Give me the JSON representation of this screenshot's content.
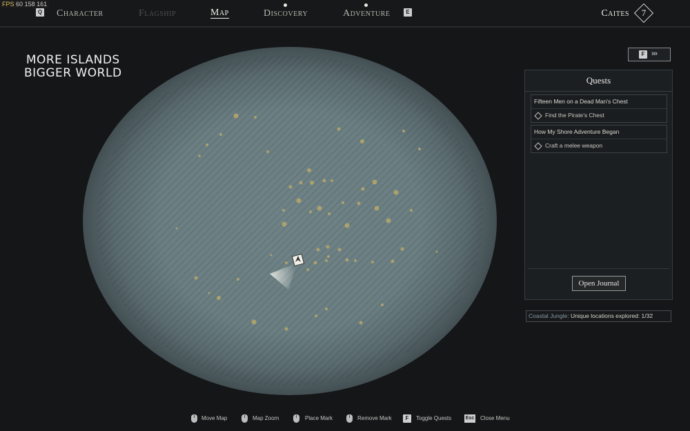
{
  "debug": {
    "fps_label": "FPS",
    "fps_value": "60",
    "extra": "158 161"
  },
  "nav": {
    "left_key": "Q",
    "right_key": "E",
    "tabs": [
      {
        "label": "Character"
      },
      {
        "label": "Flagship"
      },
      {
        "label": "Map"
      },
      {
        "label": "Discovery"
      },
      {
        "label": "Adventure"
      }
    ],
    "active_tab": "Map",
    "disabled_tab": "Flagship"
  },
  "player": {
    "name": "Caites",
    "level": "7"
  },
  "overlay_text": {
    "line1": "MORE ISLANDS",
    "line2": "BIGGER WORLD"
  },
  "expand_button": {
    "key": "F",
    "arrows": "›››"
  },
  "quests": {
    "title": "Quests",
    "items": [
      {
        "title": "Fifteen Men on a Dead Man's Chest",
        "objective": "Find the Pirate's Chest"
      },
      {
        "title": "How My Shore Adventure Began",
        "objective": "Craft a melee weapon"
      }
    ],
    "open_journal": "Open Journal"
  },
  "exploration": {
    "region": "Coastal Jungle:",
    "text": "Unique locations explored: 1/32"
  },
  "controls": [
    {
      "icon": "mouse-drag-icon",
      "label": "Move Map"
    },
    {
      "icon": "mouse-wheel-icon",
      "label": "Map Zoom"
    },
    {
      "icon": "mouse-left-icon",
      "label": "Place Mark"
    },
    {
      "icon": "mouse-right-icon",
      "label": "Remove Mark"
    },
    {
      "key": "F",
      "label": "Toggle Quests"
    },
    {
      "key": "Esc",
      "label": "Close Menu"
    }
  ],
  "colors": {
    "background": "#141618",
    "map_water": "#6f8387",
    "island": "#b8a86a",
    "panel": "#1c1f21"
  }
}
